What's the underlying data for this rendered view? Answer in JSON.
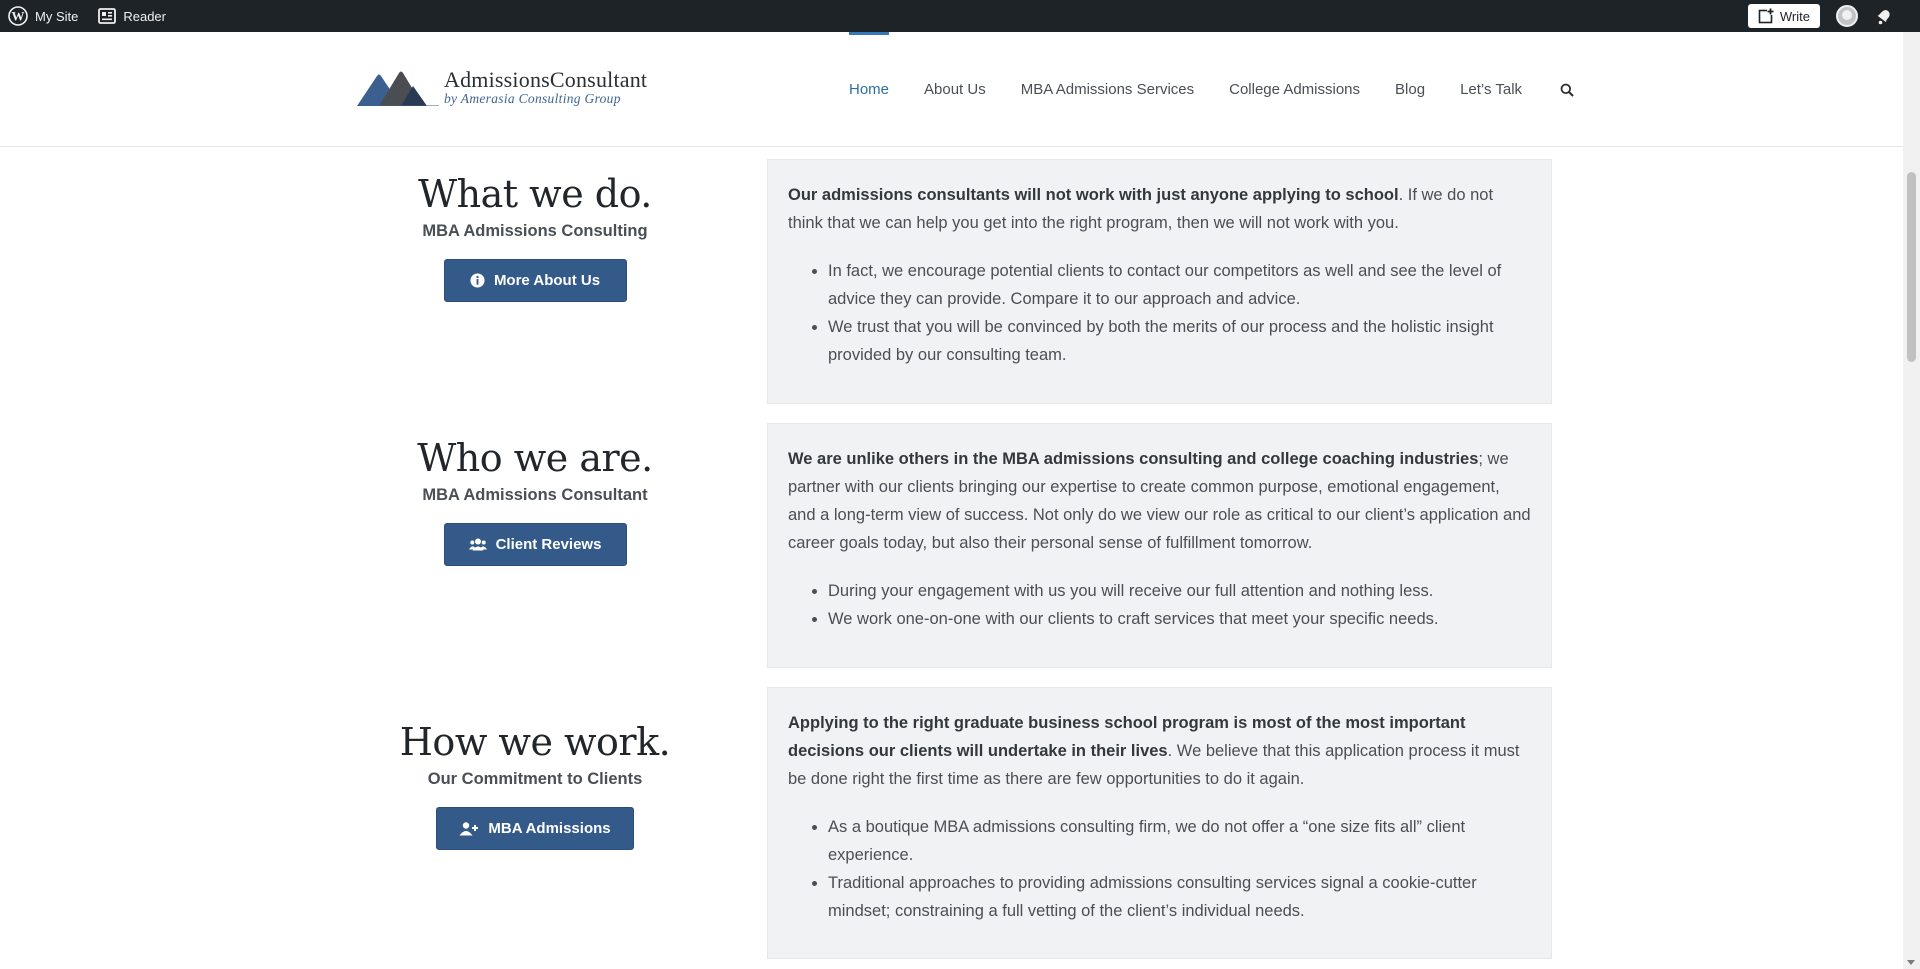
{
  "admin_bar": {
    "my_site": "My Site",
    "reader": "Reader",
    "write": "Write"
  },
  "logo": {
    "title": "AdmissionsConsultant",
    "subtitle": "by Amerasia Consulting Group"
  },
  "nav": {
    "items": [
      "Home",
      "About Us",
      "MBA Admissions Services",
      "College Admissions",
      "Blog",
      "Let’s Talk"
    ],
    "active": "Home"
  },
  "sections": [
    {
      "heading": "What we do.",
      "subheading": "MBA Admissions Consulting",
      "button": "More About Us",
      "button_icon": "info-circle-icon",
      "lead_bold": "Our admissions consultants will not work with just anyone applying to school",
      "lead_rest": ".  If we do not think that we can help you get into the right program, then we will not work with you.",
      "bullets": [
        "In fact, we encourage potential clients to contact our competitors as well and see the level of advice they can provide. Compare it to our approach and advice.",
        "We trust that you will be convinced by both the merits of our process and the holistic insight provided by our consulting team."
      ]
    },
    {
      "heading": "Who we are.",
      "subheading": "MBA Admissions Consultant",
      "button": "Client Reviews",
      "button_icon": "users-icon",
      "lead_bold": "We are unlike others in the MBA admissions consulting and college coaching industries",
      "lead_rest": "; we partner with our clients bringing our expertise to create common purpose, emotional engagement, and a long-term view of success. Not only do we view our role as critical to our client’s application and career goals today, but also their personal sense of fulfillment tomorrow.",
      "bullets": [
        "During your engagement with us you will receive our full attention and nothing less.",
        "We work one-on-one with our clients to craft services that meet your specific needs."
      ]
    },
    {
      "heading": "How we work.",
      "subheading": "Our Commitment to Clients",
      "button": "MBA Admissions",
      "button_icon": "user-plus-icon",
      "lead_bold": "Applying to the right graduate business school program is most of the most important decisions our clients will undertake in their lives",
      "lead_rest": ". We believe that this application process it must be done right the first time as there are few opportunities to do it again.",
      "bullets": [
        "As a boutique MBA admissions consulting firm, we do not offer a “one size fits all” client experience.",
        "Traditional approaches to providing admissions consulting services signal a cookie-cutter mindset; constraining a full vetting of the client’s individual needs."
      ]
    }
  ],
  "colors": {
    "admin_bar": "#1d2327",
    "accent": "#345a8a",
    "nav_active": "#2f6ea5",
    "panel_bg": "#f1f2f4"
  }
}
